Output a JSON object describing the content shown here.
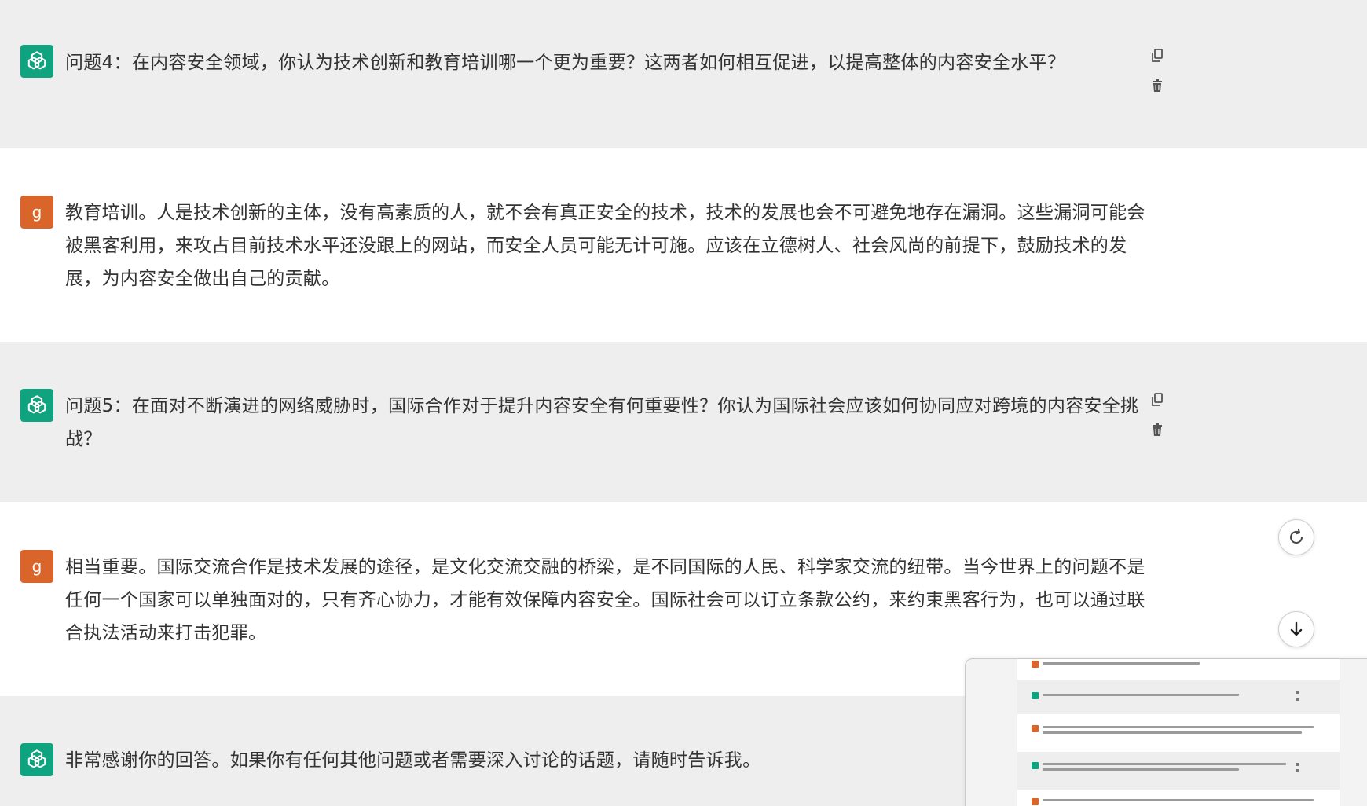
{
  "messages": [
    {
      "role": "bot",
      "text": "问题4：在内容安全领域，你认为技术创新和教育培训哪一个更为重要？这两者如何相互促进，以提高整体的内容安全水平？"
    },
    {
      "role": "user",
      "avatar_letter": "g",
      "text": "教育培训。人是技术创新的主体，没有高素质的人，就不会有真正安全的技术，技术的发展也会不可避免地存在漏洞。这些漏洞可能会被黑客利用，来攻占目前技术水平还没跟上的网站，而安全人员可能无计可施。应该在立德树人、社会风尚的前提下，鼓励技术的发展，为内容安全做出自己的贡献。"
    },
    {
      "role": "bot",
      "text": "问题5：在面对不断演进的网络威胁时，国际合作对于提升内容安全有何重要性？你认为国际社会应该如何协同应对跨境的内容安全挑战？"
    },
    {
      "role": "user",
      "avatar_letter": "g",
      "text": "相当重要。国际交流合作是技术发展的途径，是文化交流交融的桥梁，是不同国际的人民、科学家交流的纽带。当今世界上的问题不是任何一个国家可以单独面对的，只有齐心协力，才能有效保障内容安全。国际社会可以订立条款公约，来约束黑客行为，也可以通过联合执法活动来打击犯罪。"
    },
    {
      "role": "bot",
      "text": "非常感谢你的回答。如果你有任何其他问题或者需要深入讨论的话题，请随时告诉我。"
    }
  ],
  "icons": {
    "bot_avatar": "openai-logo-icon",
    "copy": "copy-icon",
    "delete": "trash-icon",
    "regenerate": "refresh-icon",
    "scroll_down": "arrow-down-icon"
  },
  "colors": {
    "bot_bg": "#eeeeee",
    "user_bg": "#ffffff",
    "bot_avatar": "#10a37f",
    "user_avatar": "#d9652b",
    "text": "#333333"
  }
}
